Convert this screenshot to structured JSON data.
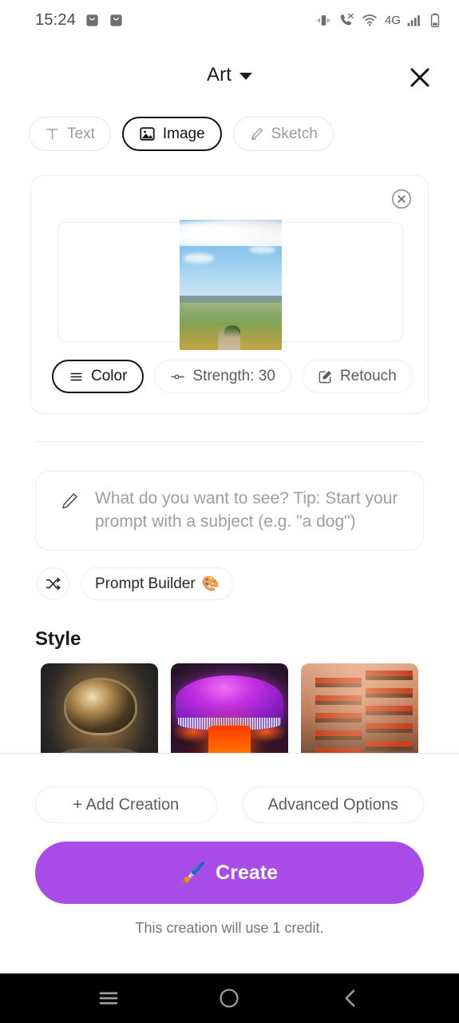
{
  "statusbar": {
    "time": "15:24",
    "left_icons": [
      "download-icon",
      "download-icon"
    ],
    "right_icons": [
      "vibrate-icon",
      "call-mute-icon",
      "wifi-icon",
      "signal-bars-icon",
      "battery-icon"
    ],
    "network_label": "4G"
  },
  "header": {
    "title": "Art",
    "dropdown_icon": "chevron-down-icon",
    "close_icon": "close-icon"
  },
  "tabs": [
    {
      "label": "Text",
      "icon": "text-icon",
      "active": false
    },
    {
      "label": "Image",
      "icon": "image-icon",
      "active": true
    },
    {
      "label": "Sketch",
      "icon": "pencil-sketch-icon",
      "active": false
    }
  ],
  "image_card": {
    "remove_icon": "circle-close-icon",
    "thumbnail_alt": "landscape-photo-rolling-hills",
    "options": [
      {
        "label": "Color",
        "icon": "lines-icon",
        "active": true
      },
      {
        "label": "Strength: 30",
        "icon": "slider-icon",
        "active": false
      },
      {
        "label": "Retouch",
        "icon": "edit-square-icon",
        "active": false
      }
    ]
  },
  "prompt": {
    "icon": "pencil-icon",
    "placeholder": "What do you want to see? Tip: Start your prompt with a subject (e.g. \"a dog\")"
  },
  "prompt_builder": {
    "shuffle_icon": "shuffle-icon",
    "label": "Prompt Builder",
    "emoji": "🎨"
  },
  "style": {
    "title": "Style",
    "cards": [
      {
        "name": "astronaut-style",
        "alt": "reflective astronaut helmet"
      },
      {
        "name": "mushroom-style",
        "alt": "glowing purple mushroom"
      },
      {
        "name": "pagoda-style",
        "alt": "red pagoda towers in mist"
      }
    ]
  },
  "bottom": {
    "add_creation_label": "+ Add Creation",
    "advanced_options_label": "Advanced Options",
    "create_label": "Create",
    "create_emoji": "🖌️",
    "create_color": "#a84ce8",
    "credit_note": "This creation will use 1 credit."
  },
  "navbar": {
    "recents_icon": "menu-icon",
    "home_icon": "circle-icon",
    "back_icon": "chevron-left-icon"
  }
}
